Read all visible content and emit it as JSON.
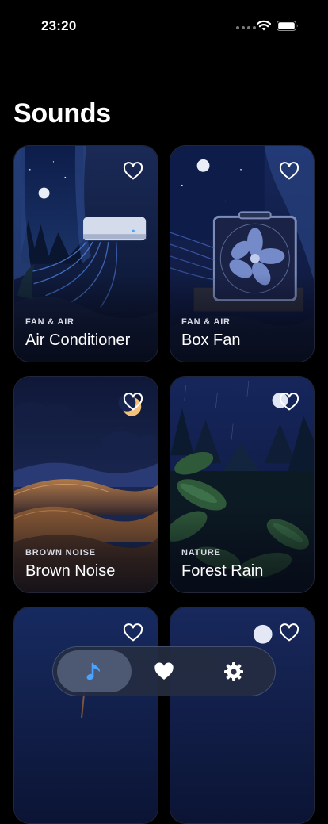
{
  "status_bar": {
    "time": "23:20"
  },
  "header": {
    "title": "Sounds"
  },
  "cards": [
    {
      "category": "FAN & AIR",
      "name": "Air Conditioner"
    },
    {
      "category": "FAN & AIR",
      "name": "Box Fan"
    },
    {
      "category": "BROWN NOISE",
      "name": "Brown Noise"
    },
    {
      "category": "NATURE",
      "name": "Forest Rain"
    },
    {
      "category": "",
      "name": ""
    },
    {
      "category": "",
      "name": ""
    }
  ],
  "tab_bar": {
    "tabs": [
      {
        "icon": "music-note-icon",
        "selected": true
      },
      {
        "icon": "heart-icon",
        "selected": false
      },
      {
        "icon": "gear-icon",
        "selected": false
      }
    ],
    "accent": "#4aa3ff"
  },
  "colors": {
    "background": "#000000",
    "card_border": "#38456a"
  }
}
